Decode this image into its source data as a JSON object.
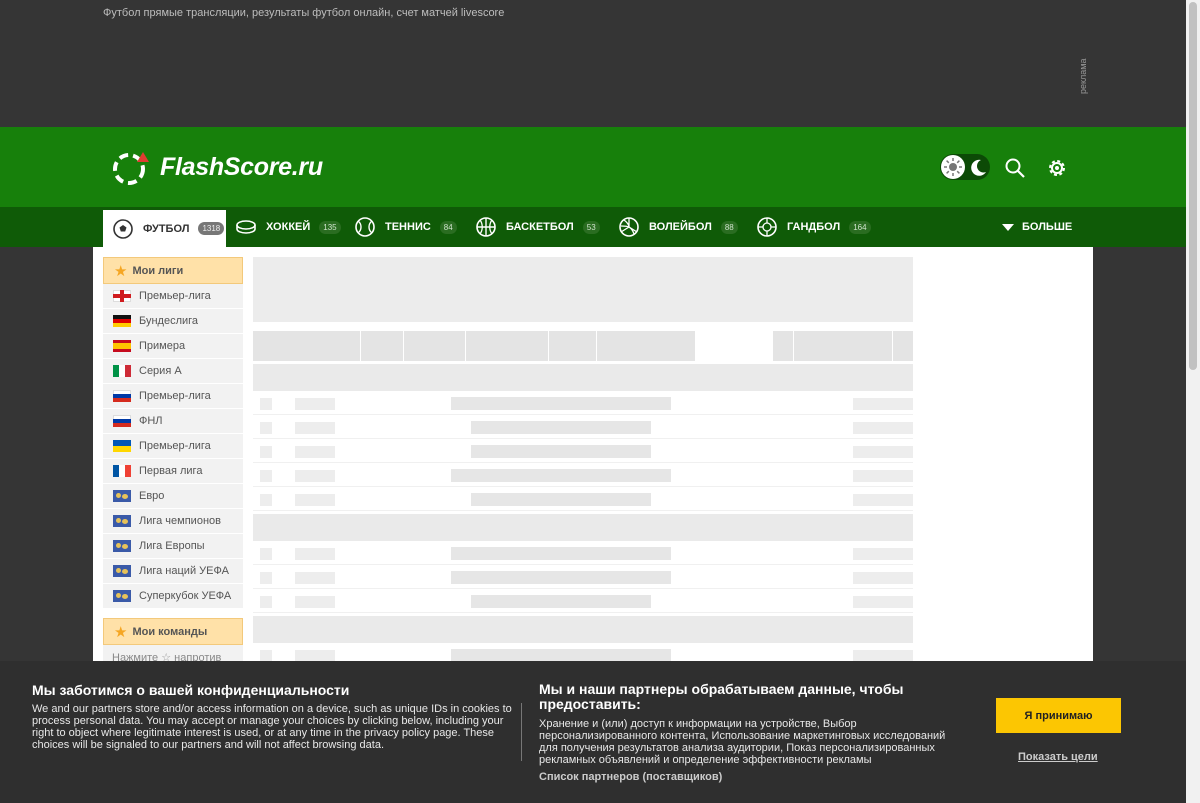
{
  "topbar": {
    "seo_text": "Футбол прямые трансляции, результаты футбол онлайн, счет матчей livescore",
    "ad_label": "реклама"
  },
  "header": {
    "logo_text": "FlashScore.ru",
    "brand_color": "#17800b"
  },
  "sports": [
    {
      "label": "ФУТБОЛ",
      "count": "1318",
      "icon": "soccer-ball-icon"
    },
    {
      "label": "ХОККЕЙ",
      "count": "135",
      "icon": "hockey-puck-icon"
    },
    {
      "label": "ТЕННИС",
      "count": "84",
      "icon": "tennis-ball-icon"
    },
    {
      "label": "БАСКЕТБОЛ",
      "count": "53",
      "icon": "basketball-icon"
    },
    {
      "label": "ВОЛЕЙБОЛ",
      "count": "88",
      "icon": "volleyball-icon"
    },
    {
      "label": "ГАНДБОЛ",
      "count": "164",
      "icon": "handball-icon"
    }
  ],
  "more_label": "БОЛЬШЕ",
  "sidebar": {
    "my_leagues_title": "Мои лиги",
    "leagues": [
      {
        "name": "Премьер-лига",
        "flag": "england"
      },
      {
        "name": "Бундеслига",
        "flag": "germany"
      },
      {
        "name": "Примера",
        "flag": "spain"
      },
      {
        "name": "Серия А",
        "flag": "italy"
      },
      {
        "name": "Премьер-лига",
        "flag": "russia"
      },
      {
        "name": "ФНЛ",
        "flag": "russia"
      },
      {
        "name": "Премьер-лига",
        "flag": "ukraine"
      },
      {
        "name": "Первая лига",
        "flag": "france"
      },
      {
        "name": "Евро",
        "flag": "world"
      },
      {
        "name": "Лига чемпионов",
        "flag": "world"
      },
      {
        "name": "Лига Европы",
        "flag": "world"
      },
      {
        "name": "Лига наций УЕФА",
        "flag": "world"
      },
      {
        "name": "Суперкубок УЕФА",
        "flag": "world"
      }
    ],
    "my_teams_title": "Мои команды",
    "my_teams_hint_before": "Нажмите",
    "my_teams_hint_after": "напротив"
  },
  "cookie": {
    "title_left": "Мы заботимся о вашей конфиденциальности",
    "text_left": "We and our partners store and/or access information on a device, such as unique IDs in cookies to process personal data. You may accept or manage your choices by clicking below, including your right to object where legitimate interest is used, or at any time in the privacy policy page. These choices will be signaled to our partners and will not affect browsing data.",
    "title_right": "Мы и наши партнеры обрабатываем данные, чтобы предоставить:",
    "text_right": "Хранение и (или) доступ к информации на устройстве, Выбор персонализированного контента, Использование маркетинговых исследований для получения результатов анализа аудитории, Показ персонализированных рекламных объявлений и определение эффективности рекламы",
    "partners_link": "Список партнеров (поставщиков)",
    "accept_button": "Я принимаю",
    "purposes_link": "Показать цели",
    "accept_color": "#fcc602"
  }
}
